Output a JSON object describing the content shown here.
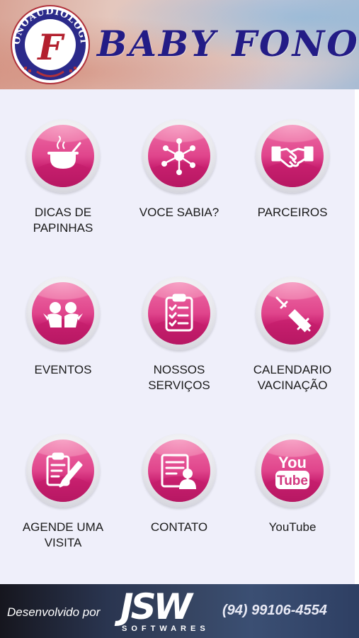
{
  "header": {
    "logo_text": "FONOAUDIOLOGIA",
    "logo_letter": "F",
    "title": "BABY FONO"
  },
  "menu": [
    {
      "label": "DICAS DE\nPAPINHAS",
      "icon": "pot-icon"
    },
    {
      "label": "VOCE SABIA?",
      "icon": "network-icon"
    },
    {
      "label": "PARCEIROS",
      "icon": "handshake-icon"
    },
    {
      "label": "EVENTOS",
      "icon": "people-icon"
    },
    {
      "label": "NOSSOS\nSERVIÇOS",
      "icon": "checklist-icon"
    },
    {
      "label": "CALENDARIO\nVACINAÇÃO",
      "icon": "syringe-icon"
    },
    {
      "label": "AGENDE UMA\nVISITA",
      "icon": "clipboard-pencil-icon"
    },
    {
      "label": "CONTATO",
      "icon": "contact-card-icon"
    },
    {
      "label": "YouTube",
      "icon": "youtube-icon"
    }
  ],
  "footer": {
    "developed_by": "Desenvolvido por",
    "company": "JSW",
    "company_sub": "SOFTWARES",
    "phone": "(94) 99106-4554"
  },
  "colors": {
    "accent_pink": "#e0458c",
    "title_blue": "#231c86",
    "background": "#efeffa"
  }
}
